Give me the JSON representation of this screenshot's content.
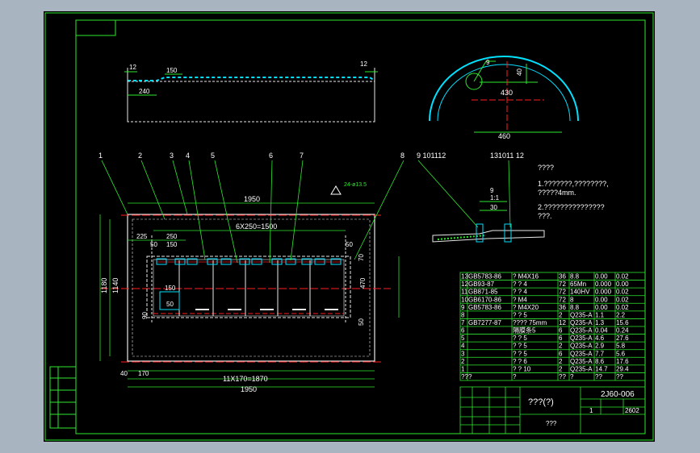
{
  "colors": {
    "background": "#000000",
    "frame": "#2ee82e",
    "text": "#ffffff",
    "dimension": "#00e0ff",
    "center_line": "#ff2020",
    "part": "#e8e8e8",
    "screen": "#a8b4c0"
  },
  "top_view": {
    "dim_12_left": "12",
    "dim_12_right": "12",
    "dim_150": "150",
    "dim_240": "240"
  },
  "arc_view": {
    "tag": "9",
    "dim_40": "40",
    "dim_430": "430",
    "dim_460": "460"
  },
  "balloons": [
    "1",
    "2",
    "3",
    "4",
    "5",
    "6",
    "7",
    "8"
  ],
  "main_view": {
    "dim_1950_top": "1950",
    "dim_6x250": "6X250=1500",
    "dim_225": "225",
    "dim_250": "250",
    "dim_50a": "50",
    "dim_150a": "150",
    "dim_50_right": "50",
    "dim_470": "470",
    "dim_1180": "1180",
    "dim_1140": "1140",
    "dim_150_small": "150",
    "dim_50_small": "50",
    "dim_90": "90",
    "dim_40": "40",
    "dim_170": "170",
    "dim_11x170": "11X170=1870",
    "dim_1950_bottom": "1950",
    "dim_70_right": "70",
    "dim_50_bottom_right": "50",
    "weld_note": "24-ø13.5"
  },
  "detail": {
    "balloons_left": "9 101112",
    "balloons_right": "131011 12",
    "dim_9": "9",
    "dim_11": "1:1",
    "dim_30": "30"
  },
  "notes": {
    "title": "????",
    "line1a": "1.???????,????????,",
    "line1b": "?????4mm.",
    "line2a": "2.???????????????",
    "line2b": "???."
  },
  "bom_rows": [
    {
      "no": "13",
      "code": "GB5783-86",
      "name": "?  M4X16",
      "qty": "36",
      "mat": "8.8",
      "wt": "0.00",
      "twt": "0.02"
    },
    {
      "no": "12",
      "code": "GB93-87",
      "name": "? ? 4",
      "qty": "72",
      "mat": "65Mn",
      "wt": "0.000",
      "twt": "0.00"
    },
    {
      "no": "11",
      "code": "GB871-85",
      "name": "? ? 4",
      "qty": "72",
      "mat": "140HV",
      "wt": "0.000",
      "twt": "0.02"
    },
    {
      "no": "10",
      "code": "GB6170-86",
      "name": "?  M4",
      "qty": "72",
      "mat": "8",
      "wt": "0.00",
      "twt": "0.02"
    },
    {
      "no": "9",
      "code": "GB5783-86",
      "name": "?  M4X20",
      "qty": "36",
      "mat": "8.8",
      "wt": "0.00",
      "twt": "0.02"
    },
    {
      "no": "8",
      "code": "",
      "name": "? ? 5",
      "qty": "2",
      "mat": "Q235-A",
      "wt": "1.1",
      "twt": "2.2"
    },
    {
      "no": "7",
      "code": "GB7277-87",
      "name": "???? 75mm",
      "qty": "12",
      "mat": "Q235-A",
      "wt": "1.3",
      "twt": "15.6"
    },
    {
      "no": "6",
      "code": "",
      "name": "隔膜条5",
      "qty": "6",
      "mat": "Q235-A",
      "wt": "0.04",
      "twt": "0.24"
    },
    {
      "no": "5",
      "code": "",
      "name": "? ? 5",
      "qty": "6",
      "mat": "Q235-A",
      "wt": "4.6",
      "twt": "27.6"
    },
    {
      "no": "4",
      "code": "",
      "name": "? ? 5",
      "qty": "2",
      "mat": "Q235-A",
      "wt": "2.9",
      "twt": "5.8"
    },
    {
      "no": "3",
      "code": "",
      "name": "? ? 5",
      "qty": "6",
      "mat": "Q235-A",
      "wt": "7.7",
      "twt": "5.6"
    },
    {
      "no": "2",
      "code": "",
      "name": "? ? 6",
      "qty": "2",
      "mat": "Q235-A",
      "wt": "8.6",
      "twt": "17.6"
    },
    {
      "no": "1",
      "code": "",
      "name": "? ? 10",
      "qty": "2",
      "mat": "Q235-A",
      "wt": "14.7",
      "twt": "29.4"
    },
    {
      "no": "??",
      "code": "?",
      "name": "?",
      "qty": "??",
      "mat": "?",
      "wt": "??",
      "twt": "??"
    }
  ],
  "title_block": {
    "name": "???(?)",
    "drawing_no": "2J60-006",
    "company": "???",
    "scale_ref": "1",
    "sheet": "2602"
  }
}
